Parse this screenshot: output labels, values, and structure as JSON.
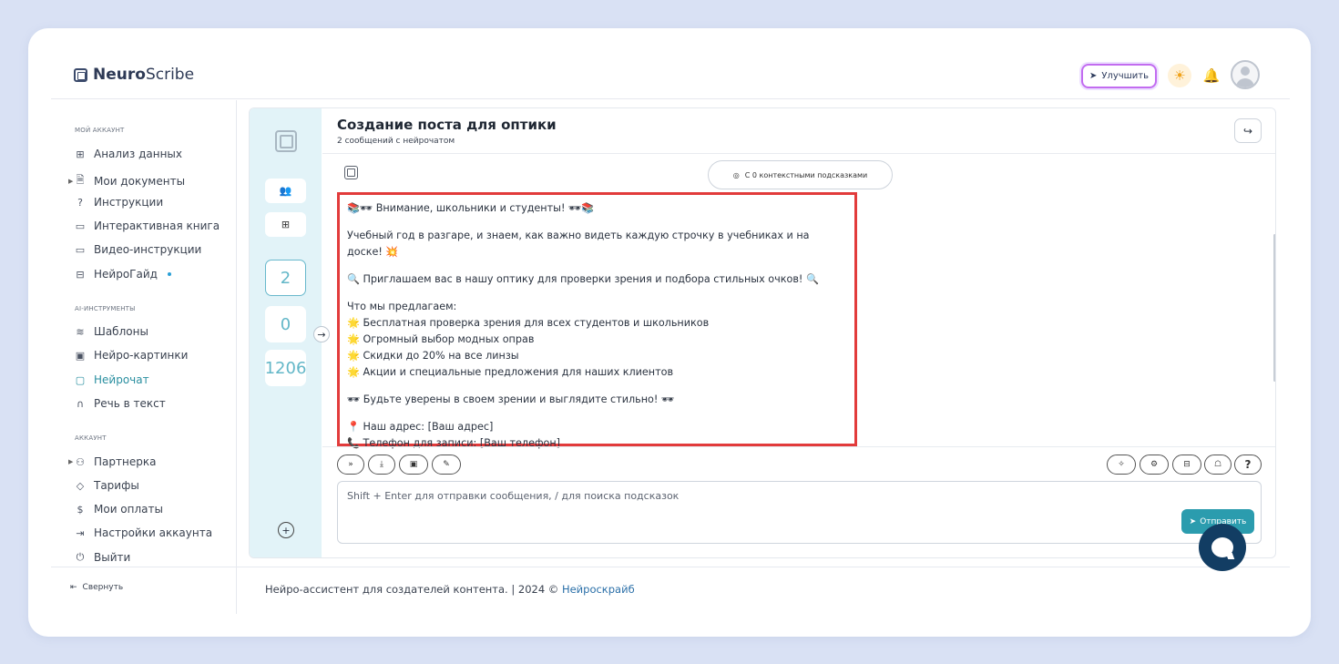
{
  "brand": {
    "bold": "Neuro",
    "rest": "Scribe"
  },
  "header": {
    "upgrade_label": "Улучшить"
  },
  "sidebar": {
    "section_account": "МОЙ АККАУНТ",
    "section_ai": "AI-ИНСТРУМЕНТЫ",
    "section_acc2": "АККАУНТ",
    "items": {
      "analytics": "Анализ данных",
      "documents": "Мои документы",
      "instructions": "Инструкции",
      "book": "Интерактивная книга",
      "video": "Видео-инструкции",
      "guide": "НейроГайд",
      "templates": "Шаблоны",
      "images": "Нейро-картинки",
      "chat": "Нейрочат",
      "speech": "Речь в текст",
      "partner": "Партнерка",
      "tariffs": "Тарифы",
      "payments": "Мои оплаты",
      "settings": "Настройки аккаунта",
      "logout": "Выйти"
    },
    "collapse": "Свернуть"
  },
  "rail": {
    "counts": [
      "2",
      "0",
      "1206"
    ]
  },
  "chat": {
    "title": "Создание поста для оптики",
    "subtitle": "2 сообщений с нейрочатом",
    "hints_label": "С 0 контекстными подсказками",
    "message": {
      "l1": "📚🕶 Внимание, школьники и студенты! 🕶📚",
      "l2": "Учебный год в разгаре, и знаем, как важно видеть каждую строчку в учебниках и на доске! 💥",
      "l3": "🔍 Приглашаем вас в нашу оптику для проверки зрения и подбора стильных очков! 🔍",
      "l4": "Что мы предлагаем:",
      "l5": "🌟 Бесплатная проверка зрения для всех студентов и школьников",
      "l6": "🌟 Огромный выбор модных оправ",
      "l7": "🌟 Скидки до 20% на все линзы",
      "l8": "🌟 Акции и специальные предложения для наших клиентов",
      "l9": "🕶 Будьте уверены в своем зрении и выглядите стильно! 🕶",
      "l10": "📍 Наш адрес: [Ваш адрес]",
      "l11": "📞 Телефон для записи: [Ваш телефон]"
    },
    "input_placeholder": "Shift + Enter для отправки сообщения, / для поиска подсказок",
    "send_label": "Отправить",
    "help_label": "?"
  },
  "footer": {
    "text": "Нейро-ассистент для создателей контента.  | 2024 © ",
    "link": "Нейроскрайб"
  }
}
